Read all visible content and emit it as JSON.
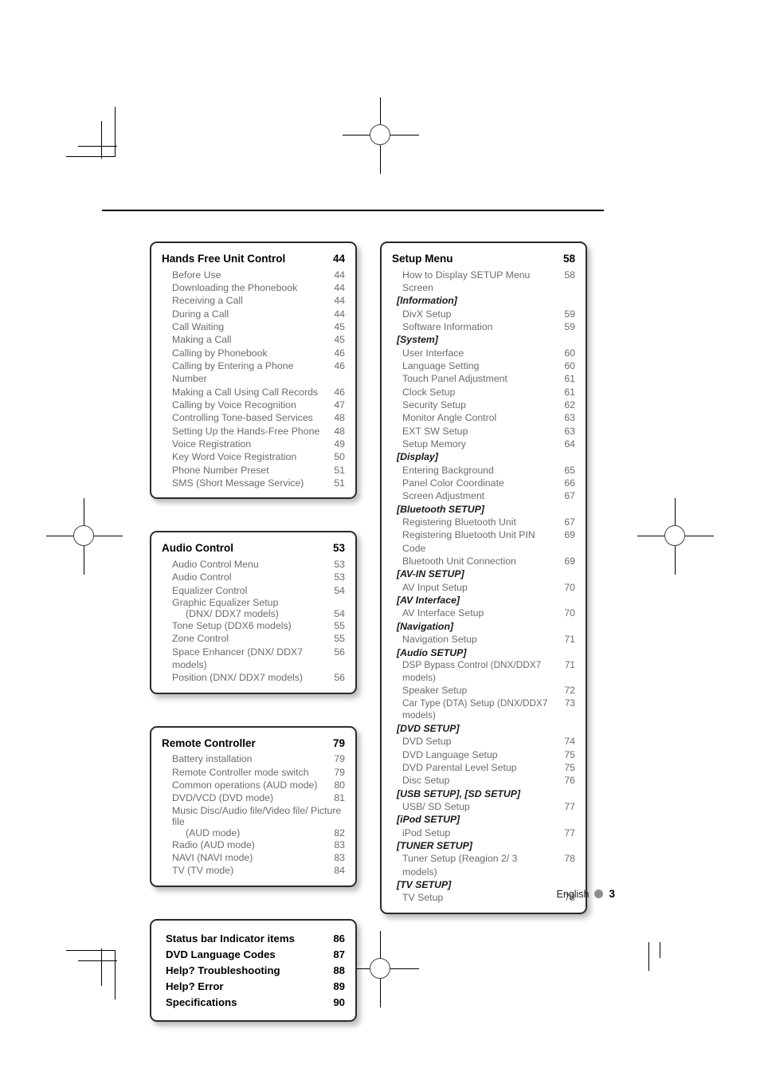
{
  "footer": {
    "language": "English",
    "page_number": "3"
  },
  "left_column": {
    "boxes": [
      {
        "name": "hands-free-unit-control",
        "title": "Hands Free Unit Control",
        "page": "44",
        "entries": [
          {
            "label": "Before Use",
            "page": "44"
          },
          {
            "label": "Downloading the Phonebook",
            "page": "44"
          },
          {
            "label": "Receiving a Call",
            "page": "44"
          },
          {
            "label": "During a Call",
            "page": "44"
          },
          {
            "label": "Call Waiting",
            "page": "45"
          },
          {
            "label": "Making a Call",
            "page": "45"
          },
          {
            "label": "Calling by Phonebook",
            "page": "46"
          },
          {
            "label": "Calling by Entering a Phone Number",
            "page": "46"
          },
          {
            "label": "Making a Call Using Call Records",
            "page": "46"
          },
          {
            "label": "Calling by Voice Recognition",
            "page": "47"
          },
          {
            "label": "Controlling Tone-based Services",
            "page": "48"
          },
          {
            "label": "Setting Up the Hands-Free Phone",
            "page": "48"
          },
          {
            "label": "Voice Registration",
            "page": "49"
          },
          {
            "label": "Key Word Voice Registration",
            "page": "50"
          },
          {
            "label": "Phone Number Preset",
            "page": "51"
          },
          {
            "label": "SMS (Short Message Service)",
            "page": "51"
          }
        ]
      },
      {
        "name": "audio-control",
        "title": "Audio Control",
        "page": "53",
        "entries": [
          {
            "label": "Audio Control Menu",
            "page": "53"
          },
          {
            "label": "Audio Control",
            "page": "53"
          },
          {
            "label": "Equalizer Control",
            "page": "54"
          },
          {
            "label": "Graphic Equalizer Setup",
            "label2": "(DNX/ DDX7 models)",
            "page": "54"
          },
          {
            "label": "Tone Setup (DDX6 models)",
            "page": "55"
          },
          {
            "label": "Zone Control",
            "page": "55"
          },
          {
            "label": "Space Enhancer (DNX/ DDX7 models)",
            "page": "56"
          },
          {
            "label": "Position (DNX/ DDX7 models)",
            "page": "56"
          }
        ]
      },
      {
        "name": "remote-controller",
        "title": "Remote Controller",
        "page": "79",
        "entries": [
          {
            "label": "Battery installation",
            "page": "79"
          },
          {
            "label": "Remote Controller mode switch",
            "page": "79"
          },
          {
            "label": "Common operations (AUD mode)",
            "page": "80"
          },
          {
            "label": "DVD/VCD (DVD mode)",
            "page": "81"
          },
          {
            "label": "Music Disc/Audio file/Video file/ Picture file",
            "label2": "(AUD mode)",
            "page": "82"
          },
          {
            "label": "Radio (AUD mode)",
            "page": "83"
          },
          {
            "label": "NAVI (NAVI mode)",
            "page": "83"
          },
          {
            "label": "TV (TV mode)",
            "page": "84"
          }
        ]
      },
      {
        "name": "appendix-list",
        "bold_entries": [
          {
            "label": "Status bar Indicator items",
            "page": "86"
          },
          {
            "label": "DVD Language Codes",
            "page": "87"
          },
          {
            "label": "Help? Troubleshooting",
            "page": "88"
          },
          {
            "label": "Help? Error",
            "page": "89"
          },
          {
            "label": "Specifications",
            "page": "90"
          }
        ]
      }
    ]
  },
  "right_column": {
    "boxes": [
      {
        "name": "setup-menu",
        "title": "Setup Menu",
        "page": "58",
        "entries": [
          {
            "label": "How to Display SETUP Menu Screen",
            "page": "58"
          },
          {
            "section": "[Information]"
          },
          {
            "label": "DivX Setup",
            "page": "59"
          },
          {
            "label": "Software Information",
            "page": "59"
          },
          {
            "section": "[System]"
          },
          {
            "label": "User Interface",
            "page": "60"
          },
          {
            "label": "Language Setting",
            "page": "60"
          },
          {
            "label": "Touch Panel Adjustment",
            "page": "61"
          },
          {
            "label": "Clock Setup",
            "page": "61"
          },
          {
            "label": "Security Setup",
            "page": "62"
          },
          {
            "label": "Monitor Angle Control",
            "page": "63"
          },
          {
            "label": "EXT SW Setup",
            "page": "63"
          },
          {
            "label": "Setup Memory",
            "page": "64"
          },
          {
            "section": "[Display]"
          },
          {
            "label": "Entering Background",
            "page": "65"
          },
          {
            "label": "Panel Color Coordinate",
            "page": "66"
          },
          {
            "label": "Screen Adjustment",
            "page": "67"
          },
          {
            "section": "[Bluetooth SETUP]"
          },
          {
            "label": "Registering Bluetooth Unit",
            "page": "67"
          },
          {
            "label": "Registering Bluetooth Unit PIN Code",
            "page": "69"
          },
          {
            "label": "Bluetooth Unit Connection",
            "page": "69"
          },
          {
            "section": "[AV-IN SETUP]"
          },
          {
            "label": "AV Input Setup",
            "page": "70"
          },
          {
            "section": "[AV Interface]"
          },
          {
            "label": "AV Interface Setup",
            "page": "70"
          },
          {
            "section": "[Navigation]"
          },
          {
            "label": "Navigation Setup",
            "page": "71"
          },
          {
            "section": "[Audio SETUP]"
          },
          {
            "label": "DSP Bypass Control (DNX/DDX7 models)",
            "page": "71"
          },
          {
            "label": "Speaker Setup",
            "page": "72"
          },
          {
            "label": "Car Type (DTA) Setup (DNX/DDX7 models)",
            "page": "73"
          },
          {
            "section": "[DVD SETUP]"
          },
          {
            "label": "DVD Setup",
            "page": "74"
          },
          {
            "label": "DVD Language Setup",
            "page": "75"
          },
          {
            "label": "DVD Parental Level Setup",
            "page": "75"
          },
          {
            "label": "Disc Setup",
            "page": "76"
          },
          {
            "section": "[USB SETUP], [SD SETUP]"
          },
          {
            "label": "USB/ SD Setup",
            "page": "77"
          },
          {
            "section": "[iPod SETUP]"
          },
          {
            "label": "iPod Setup",
            "page": "77"
          },
          {
            "section": "[TUNER SETUP]"
          },
          {
            "label": "Tuner Setup (Reagion 2/ 3 models)",
            "page": "78"
          },
          {
            "section": "[TV SETUP]"
          },
          {
            "label": "TV Setup",
            "page": "78"
          }
        ]
      }
    ]
  }
}
